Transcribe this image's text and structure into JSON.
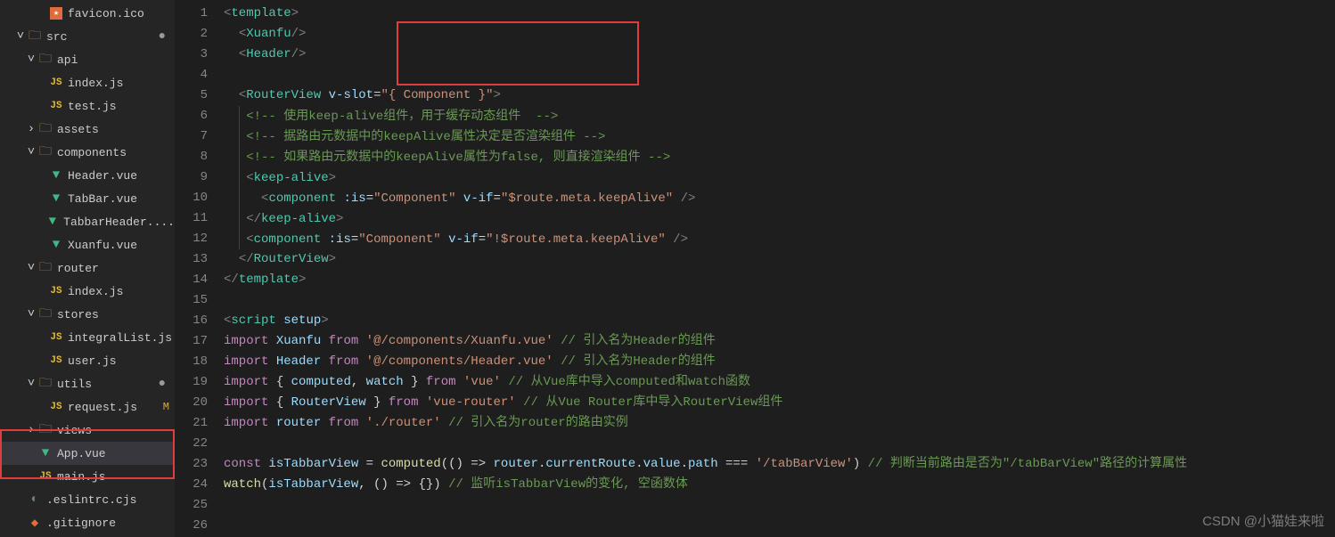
{
  "sidebar": {
    "items": [
      {
        "label": "favicon.ico",
        "icon": "star",
        "indent": 3,
        "chev": ""
      },
      {
        "label": "src",
        "icon": "folder",
        "indent": 1,
        "chev": "down",
        "mod": true
      },
      {
        "label": "api",
        "icon": "folder",
        "indent": 2,
        "chev": "down"
      },
      {
        "label": "index.js",
        "icon": "js",
        "indent": 3,
        "chev": ""
      },
      {
        "label": "test.js",
        "icon": "js",
        "indent": 3,
        "chev": ""
      },
      {
        "label": "assets",
        "icon": "folder",
        "indent": 2,
        "chev": "right"
      },
      {
        "label": "components",
        "icon": "folder",
        "indent": 2,
        "chev": "down"
      },
      {
        "label": "Header.vue",
        "icon": "vue",
        "indent": 3,
        "chev": ""
      },
      {
        "label": "TabBar.vue",
        "icon": "vue",
        "indent": 3,
        "chev": ""
      },
      {
        "label": "TabbarHeader....",
        "icon": "vue",
        "indent": 3,
        "chev": ""
      },
      {
        "label": "Xuanfu.vue",
        "icon": "vue",
        "indent": 3,
        "chev": ""
      },
      {
        "label": "router",
        "icon": "folder",
        "indent": 2,
        "chev": "down"
      },
      {
        "label": "index.js",
        "icon": "js",
        "indent": 3,
        "chev": ""
      },
      {
        "label": "stores",
        "icon": "folder",
        "indent": 2,
        "chev": "down"
      },
      {
        "label": "integralList.js",
        "icon": "js",
        "indent": 3,
        "chev": ""
      },
      {
        "label": "user.js",
        "icon": "js",
        "indent": 3,
        "chev": ""
      },
      {
        "label": "utils",
        "icon": "folder",
        "indent": 2,
        "chev": "down",
        "mod": true
      },
      {
        "label": "request.js",
        "icon": "js",
        "indent": 3,
        "chev": "",
        "m": true
      },
      {
        "label": "views",
        "icon": "folder",
        "indent": 2,
        "chev": "right"
      },
      {
        "label": "App.vue",
        "icon": "vue",
        "indent": 2,
        "chev": "",
        "active": true
      },
      {
        "label": "main.js",
        "icon": "js",
        "indent": 2,
        "chev": ""
      },
      {
        "label": ".eslintrc.cjs",
        "icon": "config",
        "indent": 1,
        "chev": ""
      },
      {
        "label": ".gitignore",
        "icon": "git",
        "indent": 1,
        "chev": ""
      }
    ]
  },
  "code": {
    "lines": [
      {
        "n": 1,
        "html": "<span class='tag'>&lt;</span><span class='el'>template</span><span class='tag'>&gt;</span>"
      },
      {
        "n": 2,
        "html": "  <span class='tag'>&lt;</span><span class='el'>Xuanfu</span><span class='tag'>/&gt;</span>"
      },
      {
        "n": 3,
        "html": "  <span class='tag'>&lt;</span><span class='el'>Header</span><span class='tag'>/&gt;</span>"
      },
      {
        "n": 4,
        "html": ""
      },
      {
        "n": 5,
        "html": "  <span class='tag'>&lt;</span><span class='el'>RouterView</span> <span class='attr'>v-slot</span><span class='op'>=</span><span class='str'>\"{ Component }\"</span><span class='tag'>&gt;</span>"
      },
      {
        "n": 6,
        "html": "  <span class='guide'></span> <span class='cmt'>&lt;!-- 使用keep-alive组件，用于缓存动态组件  --&gt;</span>"
      },
      {
        "n": 7,
        "html": "  <span class='guide'></span> <span class='cmt'>&lt;!-- 据路由元数据中的keepAlive属性决定是否渲染组件 --&gt;</span>"
      },
      {
        "n": 8,
        "html": "  <span class='guide'></span> <span class='cmt'>&lt;!-- 如果路由元数据中的keepAlive属性为false, 则直接渲染组件 --&gt;</span>"
      },
      {
        "n": 9,
        "html": "  <span class='guide'></span> <span class='tag'>&lt;</span><span class='el'>keep-alive</span><span class='tag'>&gt;</span>"
      },
      {
        "n": 10,
        "html": "  <span class='guide'></span>   <span class='tag'>&lt;</span><span class='el'>component</span> <span class='attr'>:is</span><span class='op'>=</span><span class='str'>\"Component\"</span> <span class='attr'>v-if</span><span class='op'>=</span><span class='str'>\"$route.meta.keepAlive\"</span> <span class='tag'>/&gt;</span>"
      },
      {
        "n": 11,
        "html": "  <span class='guide'></span> <span class='tag'>&lt;/</span><span class='el'>keep-alive</span><span class='tag'>&gt;</span>"
      },
      {
        "n": 12,
        "html": "  <span class='guide'></span> <span class='tag'>&lt;</span><span class='el'>component</span> <span class='attr'>:is</span><span class='op'>=</span><span class='str'>\"Component\"</span> <span class='attr'>v-if</span><span class='op'>=</span><span class='str'>\"!$route.meta.keepAlive\"</span> <span class='tag'>/&gt;</span>"
      },
      {
        "n": 13,
        "html": "  <span class='tag'>&lt;/</span><span class='el'>RouterView</span><span class='tag'>&gt;</span>"
      },
      {
        "n": 14,
        "html": "<span class='tag'>&lt;/</span><span class='el'>template</span><span class='tag'>&gt;</span>"
      },
      {
        "n": 15,
        "html": ""
      },
      {
        "n": 16,
        "html": "<span class='tag'>&lt;</span><span class='el'>script</span> <span class='attr'>setup</span><span class='tag'>&gt;</span>"
      },
      {
        "n": 17,
        "html": "<span class='kw'>import</span> <span class='var'>Xuanfu</span> <span class='kw'>from</span> <span class='str'>'@/components/Xuanfu.vue'</span> <span class='cmt'>// 引入名为Header的组件</span>"
      },
      {
        "n": 18,
        "html": "<span class='kw'>import</span> <span class='var'>Header</span> <span class='kw'>from</span> <span class='str'>'@/components/Header.vue'</span> <span class='cmt'>// 引入名为Header的组件</span>"
      },
      {
        "n": 19,
        "html": "<span class='kw'>import</span> <span class='op'>{</span> <span class='var'>computed</span><span class='op'>,</span> <span class='var'>watch</span> <span class='op'>}</span> <span class='kw'>from</span> <span class='str'>'vue'</span> <span class='cmt'>// 从Vue库中导入computed和watch函数</span>"
      },
      {
        "n": 20,
        "html": "<span class='kw'>import</span> <span class='op'>{</span> <span class='var'>RouterView</span> <span class='op'>}</span> <span class='kw'>from</span> <span class='str'>'vue-router'</span> <span class='cmt'>// 从Vue Router库中导入RouterView组件</span>"
      },
      {
        "n": 21,
        "html": "<span class='kw'>import</span> <span class='var'>router</span> <span class='kw'>from</span> <span class='str'>'./router'</span> <span class='cmt'>// 引入名为router的路由实例</span>"
      },
      {
        "n": 22,
        "html": ""
      },
      {
        "n": 23,
        "html": "<span class='kw'>const</span> <span class='var'>isTabbarView</span> <span class='op'>=</span> <span class='fn'>computed</span><span class='op'>(() =&gt;</span> <span class='var'>router</span><span class='op'>.</span><span class='var'>currentRoute</span><span class='op'>.</span><span class='var'>value</span><span class='op'>.</span><span class='var'>path</span> <span class='op'>===</span> <span class='str'>'/tabBarView'</span><span class='op'>)</span> <span class='cmt'>// 判断当前路由是否为\"/tabBarView\"路径的计算属性</span>"
      },
      {
        "n": 24,
        "html": "<span class='fn'>watch</span><span class='op'>(</span><span class='var'>isTabbarView</span><span class='op'>, () =&gt; {})</span> <span class='cmt'>// 监听isTabbarView的变化, 空函数体</span>"
      },
      {
        "n": 25,
        "html": ""
      },
      {
        "n": 26,
        "html": ""
      }
    ]
  },
  "watermark": "CSDN @小猫娃来啦"
}
